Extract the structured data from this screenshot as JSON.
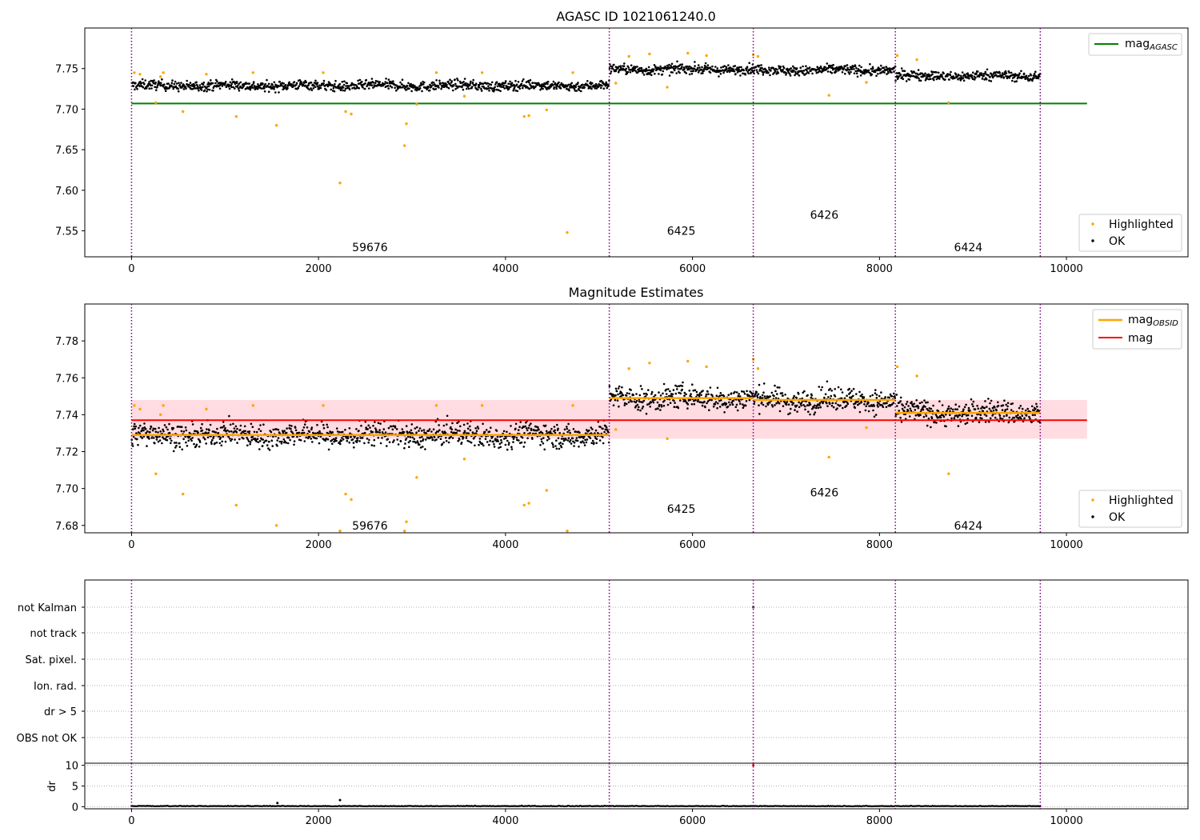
{
  "chart_data": [
    {
      "type": "scatter",
      "title": "AGASC ID 1021061240.0",
      "xlabel": "",
      "ylabel": "",
      "xlim": [
        -500,
        11300
      ],
      "ylim": [
        7.518,
        7.8
      ],
      "xticks": [
        "0",
        "2000",
        "4000",
        "6000",
        "8000",
        "10000"
      ],
      "yticks": [
        "7.55",
        "7.60",
        "7.65",
        "7.70",
        "7.75"
      ],
      "obsid_boundaries": [
        0,
        5110,
        6650,
        8170,
        9720
      ],
      "obsid_labels": [
        {
          "text": "59676",
          "x": 2550,
          "y": 7.53
        },
        {
          "text": "6425",
          "x": 5880,
          "y": 7.55
        },
        {
          "text": "6426",
          "x": 7410,
          "y": 7.57
        },
        {
          "text": "6424",
          "x": 8950,
          "y": 7.53
        }
      ],
      "segments": [
        {
          "x0": 0,
          "x1": 5110,
          "level": 7.729,
          "spread": 0.006
        },
        {
          "x0": 5110,
          "x1": 6650,
          "level": 7.749,
          "spread": 0.006
        },
        {
          "x0": 6650,
          "x1": 8170,
          "level": 7.748,
          "spread": 0.006
        },
        {
          "x0": 8170,
          "x1": 9720,
          "level": 7.741,
          "spread": 0.006
        }
      ],
      "reference_line": {
        "name": "mag",
        "subscript": "AGASC",
        "y": 7.707,
        "x0": 0,
        "x1": 10220,
        "color": "#008000"
      },
      "highlighted_points": [
        [
          30,
          7.745
        ],
        [
          90,
          7.743
        ],
        [
          260,
          7.708
        ],
        [
          310,
          7.74
        ],
        [
          340,
          7.745
        ],
        [
          550,
          7.697
        ],
        [
          800,
          7.743
        ],
        [
          1120,
          7.691
        ],
        [
          1300,
          7.745
        ],
        [
          1550,
          7.68
        ],
        [
          2050,
          7.745
        ],
        [
          2230,
          7.609
        ],
        [
          2290,
          7.697
        ],
        [
          2350,
          7.694
        ],
        [
          2920,
          7.655
        ],
        [
          2940,
          7.682
        ],
        [
          3050,
          7.706
        ],
        [
          3260,
          7.745
        ],
        [
          3560,
          7.716
        ],
        [
          3750,
          7.745
        ],
        [
          4200,
          7.691
        ],
        [
          4250,
          7.692
        ],
        [
          4440,
          7.699
        ],
        [
          4660,
          7.548
        ],
        [
          4720,
          7.745
        ],
        [
          5180,
          7.732
        ],
        [
          5320,
          7.765
        ],
        [
          5540,
          7.768
        ],
        [
          5730,
          7.727
        ],
        [
          5950,
          7.769
        ],
        [
          6150,
          7.766
        ],
        [
          6650,
          7.767
        ],
        [
          6700,
          7.765
        ],
        [
          7460,
          7.717
        ],
        [
          7860,
          7.733
        ],
        [
          8190,
          7.766
        ],
        [
          8400,
          7.761
        ],
        [
          8740,
          7.708
        ]
      ],
      "legend": {
        "top_right": [
          "mag_AGASC"
        ],
        "bottom_right": [
          "Highlighted",
          "OK"
        ]
      },
      "series": [
        {
          "name": "Highlighted",
          "color": "#FFA500"
        },
        {
          "name": "OK",
          "color": "#000000"
        }
      ]
    },
    {
      "type": "scatter",
      "title": "Magnitude Estimates",
      "xlabel": "",
      "ylabel": "",
      "xlim": [
        -500,
        11300
      ],
      "ylim": [
        7.676,
        7.8
      ],
      "xticks": [
        "0",
        "2000",
        "4000",
        "6000",
        "8000",
        "10000"
      ],
      "yticks": [
        "7.68",
        "7.70",
        "7.72",
        "7.74",
        "7.76",
        "7.78"
      ],
      "obsid_boundaries": [
        0,
        5110,
        6650,
        8170,
        9720
      ],
      "obsid_labels": [
        {
          "text": "59676",
          "x": 2550,
          "y": 7.68
        },
        {
          "text": "6425",
          "x": 5880,
          "y": 7.689
        },
        {
          "text": "6426",
          "x": 7410,
          "y": 7.698
        },
        {
          "text": "6424",
          "x": 8950,
          "y": 7.68
        }
      ],
      "segments": [
        {
          "x0": 0,
          "x1": 5110,
          "level": 7.729,
          "spread": 0.006
        },
        {
          "x0": 5110,
          "x1": 6650,
          "level": 7.749,
          "spread": 0.006
        },
        {
          "x0": 6650,
          "x1": 8170,
          "level": 7.748,
          "spread": 0.006
        },
        {
          "x0": 8170,
          "x1": 9720,
          "level": 7.741,
          "spread": 0.006
        }
      ],
      "obsid_means": [
        {
          "x0": 0,
          "x1": 5110,
          "y": 7.729
        },
        {
          "x0": 5110,
          "x1": 6650,
          "y": 7.749
        },
        {
          "x0": 6650,
          "x1": 8170,
          "y": 7.748
        },
        {
          "x0": 8170,
          "x1": 9720,
          "y": 7.741
        }
      ],
      "mean_line": {
        "y": 7.737,
        "x0": 0,
        "x1": 10220,
        "band": [
          7.727,
          7.748
        ]
      },
      "highlighted_points": [
        [
          30,
          7.745
        ],
        [
          90,
          7.743
        ],
        [
          260,
          7.708
        ],
        [
          310,
          7.74
        ],
        [
          340,
          7.745
        ],
        [
          550,
          7.697
        ],
        [
          800,
          7.743
        ],
        [
          1120,
          7.691
        ],
        [
          1300,
          7.745
        ],
        [
          1550,
          7.68
        ],
        [
          2050,
          7.745
        ],
        [
          2230,
          7.677
        ],
        [
          2290,
          7.697
        ],
        [
          2350,
          7.694
        ],
        [
          2920,
          7.677
        ],
        [
          2940,
          7.682
        ],
        [
          3050,
          7.706
        ],
        [
          3260,
          7.745
        ],
        [
          3560,
          7.716
        ],
        [
          3750,
          7.745
        ],
        [
          4200,
          7.691
        ],
        [
          4250,
          7.692
        ],
        [
          4440,
          7.699
        ],
        [
          4660,
          7.677
        ],
        [
          4720,
          7.745
        ],
        [
          5180,
          7.732
        ],
        [
          5320,
          7.765
        ],
        [
          5540,
          7.768
        ],
        [
          5730,
          7.727
        ],
        [
          5950,
          7.769
        ],
        [
          6150,
          7.766
        ],
        [
          6650,
          7.77
        ],
        [
          6700,
          7.765
        ],
        [
          7460,
          7.717
        ],
        [
          7860,
          7.733
        ],
        [
          8190,
          7.766
        ],
        [
          8400,
          7.761
        ],
        [
          8740,
          7.708
        ]
      ],
      "legend": {
        "top_right": [
          "mag_OBSID",
          "mag"
        ],
        "bottom_right": [
          "Highlighted",
          "OK"
        ]
      },
      "series": [
        {
          "name": "mag_OBSID",
          "color": "#FFA500"
        },
        {
          "name": "mag",
          "color": "#FF0000"
        },
        {
          "name": "Highlighted",
          "color": "#FFA500"
        },
        {
          "name": "OK",
          "color": "#000000"
        }
      ]
    },
    {
      "type": "scatter",
      "title": "",
      "xlabel": "",
      "ylabel": "",
      "xlim": [
        -500,
        11300
      ],
      "categories": [
        "not Kalman",
        "not track",
        "Sat. pixel.",
        "Ion. rad.",
        "dr > 5",
        "OBS not OK"
      ],
      "obsid_boundaries": [
        0,
        5110,
        6650,
        8170,
        9720
      ],
      "flag_points": [
        {
          "category": "not Kalman",
          "x": 6650
        }
      ]
    },
    {
      "type": "scatter",
      "title": "",
      "xlabel": "",
      "ylabel": "dr",
      "xlim": [
        -500,
        11300
      ],
      "ylim": [
        -0.5,
        10.5
      ],
      "xticks": [
        "0",
        "2000",
        "4000",
        "6000",
        "8000",
        "10000"
      ],
      "yticks": [
        "0",
        "5",
        "10"
      ],
      "obsid_boundaries": [
        0,
        5110,
        6650,
        8170,
        9720
      ],
      "x_range": [
        0,
        9720
      ],
      "dr_level": 0.1,
      "outliers": [
        [
          1560,
          0.9
        ],
        [
          2230,
          1.6
        ],
        [
          6650,
          10.0
        ]
      ]
    }
  ],
  "colors": {
    "ok": "#000000",
    "highlighted": "#FFA500",
    "boundary": "#800080",
    "agasc": "#008000",
    "mag": "#FF0000",
    "band": "#FFC0C8"
  }
}
